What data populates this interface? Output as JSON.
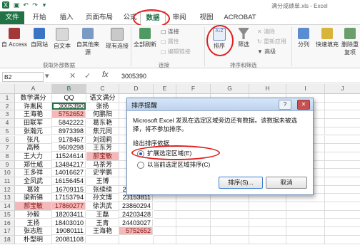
{
  "window": {
    "doc_title": "满分成绩单.xls - Excel"
  },
  "ribbon_tabs": [
    "文件",
    "开始",
    "插入",
    "页面布局",
    "公式",
    "数据",
    "审阅",
    "视图",
    "ACROBAT"
  ],
  "ribbon": {
    "get_external": [
      "自 Access",
      "自网站",
      "自文本",
      "自其他来源",
      "现有连接"
    ],
    "get_external_group": "获取外部数据",
    "refresh_all": "全部刷新",
    "connections": [
      "连接",
      "属性",
      "编辑链接"
    ],
    "connections_group": "连接",
    "sort_az": "A↓Z",
    "sort": "排序",
    "filter": "筛选",
    "filter_opts": [
      "清除",
      "重新应用",
      "高级"
    ],
    "sort_filter_group": "排序和筛选",
    "split": "分列",
    "flash_fill": "快速填充",
    "remove_dup": "删除重复项"
  },
  "formula_bar": {
    "name_box": "B2",
    "fx": "fx",
    "value": "3005390"
  },
  "grid": {
    "columns": [
      "A",
      "B",
      "C",
      "D",
      "E",
      "F",
      "G",
      "H",
      "I",
      "J"
    ],
    "rows": [
      [
        "数学满分",
        "QQ",
        "语文满分",
        "",
        ""
      ],
      [
        "许胤民",
        "3005390",
        "张扬",
        "",
        ""
      ],
      [
        "王海艳",
        "5752652",
        "何鹏阳",
        "",
        ""
      ],
      [
        "田联军",
        "5842222",
        "葛东艳",
        "",
        ""
      ],
      [
        "张瀚元",
        "8973398",
        "焦元同",
        "",
        ""
      ],
      [
        "张凡",
        "9178467",
        "刘润莉",
        "",
        ""
      ],
      [
        "高畅",
        "9609298",
        "王东芳",
        "",
        ""
      ],
      [
        "王大力",
        "11524614",
        "郝宝敏",
        "",
        ""
      ],
      [
        "郑仕威",
        "13484217",
        "马茶芳",
        "",
        ""
      ],
      [
        "王多祥",
        "14016627",
        "史学鹏",
        "",
        ""
      ],
      [
        "全凤武",
        "16156454",
        "王博",
        "",
        ""
      ],
      [
        "葛效",
        "16709115",
        "张续续",
        "23153811",
        ""
      ],
      [
        "梁新锦",
        "17153794",
        "孙文博",
        "23153811",
        ""
      ],
      [
        "郝宝敏",
        "17860277",
        "徐洪武",
        "23860294",
        ""
      ],
      [
        "孙毅",
        "18203411",
        "王磊",
        "24203428",
        ""
      ],
      [
        "王扬",
        "18403010",
        "王青",
        "24403027",
        ""
      ],
      [
        "张志胜",
        "19080111",
        "王海艳",
        "5752652",
        ""
      ],
      [
        "朴型明",
        "20081108",
        "",
        "",
        ""
      ]
    ]
  },
  "dialog": {
    "title": "排序提醒",
    "help": "?",
    "close": "✕",
    "message": "Microsoft Excel 发现在选定区域旁边还有数据。该数据未被选择，将不参加排序。",
    "group_label": "给出排序依据",
    "option_expand": "扩展选定区域(E)",
    "option_current": "以当前选定区域排序(C)",
    "sort_button": "排序(S)...",
    "cancel_button": "取消"
  }
}
